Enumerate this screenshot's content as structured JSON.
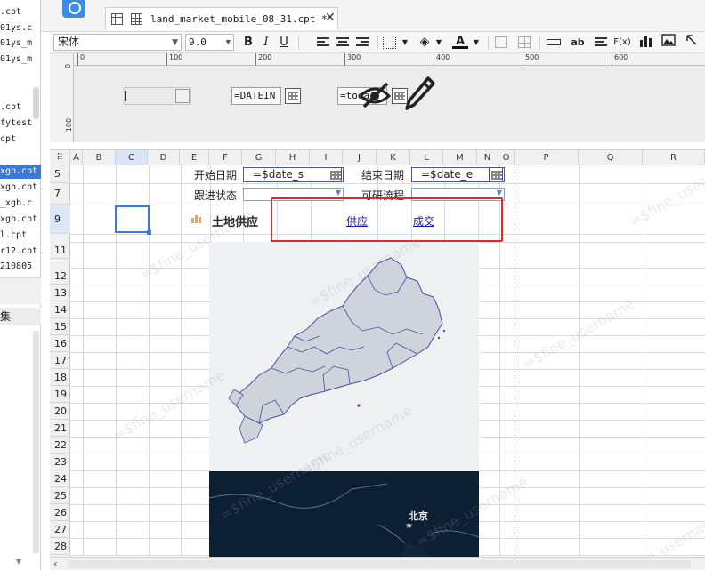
{
  "left_panel": {
    "files": [
      {
        "label": ".cpt"
      },
      {
        "label": "01ys.c"
      },
      {
        "label": "01ys_m"
      },
      {
        "label": "01ys_m"
      },
      {
        "label": ".cpt"
      },
      {
        "label": "fytest"
      },
      {
        "label": "cpt"
      },
      {
        "label": "xgb.cpt",
        "selected": true
      },
      {
        "label": "xgb.cpt"
      },
      {
        "label": "_xgb.c"
      },
      {
        "label": "xgb.cpt"
      },
      {
        "label": "l.cpt"
      },
      {
        "label": "r12.cpt"
      },
      {
        "label": "210805"
      }
    ],
    "section_label": "集"
  },
  "tab": {
    "title": "land_market_mobile_08_31.cpt *",
    "close": "✕"
  },
  "format_toolbar": {
    "font": "宋体",
    "size": "9.0",
    "bold": "B",
    "italic": "I",
    "underline": "U",
    "font_color_letter": "A",
    "ab_label": "ab",
    "fx_label": "F(x)"
  },
  "ruler": {
    "ticks": [
      "0",
      "100",
      "200",
      "300",
      "400",
      "500",
      "600"
    ],
    "v_ticks": [
      "0",
      "100"
    ]
  },
  "parameter_panel": {
    "field_date": "=DATEIN",
    "field_today": "=toda"
  },
  "columns": [
    "A",
    "B",
    "C",
    "D",
    "E",
    "F",
    "G",
    "H",
    "I",
    "J",
    "K",
    "L",
    "M",
    "N",
    "O",
    "P",
    "Q",
    "R"
  ],
  "rows": [
    "5",
    "7",
    "9",
    "11",
    "12",
    "13",
    "14",
    "15",
    "16",
    "17",
    "18",
    "19",
    "20",
    "21",
    "22",
    "23",
    "24",
    "25",
    "26",
    "27",
    "28"
  ],
  "cells": {
    "start_date_label": "开始日期",
    "start_date_value": "=$date_s",
    "end_date_label": "结束日期",
    "end_date_value": "=$date_e",
    "follow_status_label": "跟进状态",
    "research_flow_label": "可研流程",
    "land_supply_title": "土地供应",
    "link_supply": "供应",
    "link_deal": "成交"
  },
  "map": {
    "city_label": "北京"
  },
  "watermark": "=$fine_username",
  "colors": {
    "accent_blue": "#3a7bd5",
    "highlight_red": "#e02a2a",
    "link_blue": "#1a1aa0",
    "map_fill": "#cfd3dc",
    "map_stroke": "#4a4f9a",
    "dark_map": "#0d1f33"
  }
}
